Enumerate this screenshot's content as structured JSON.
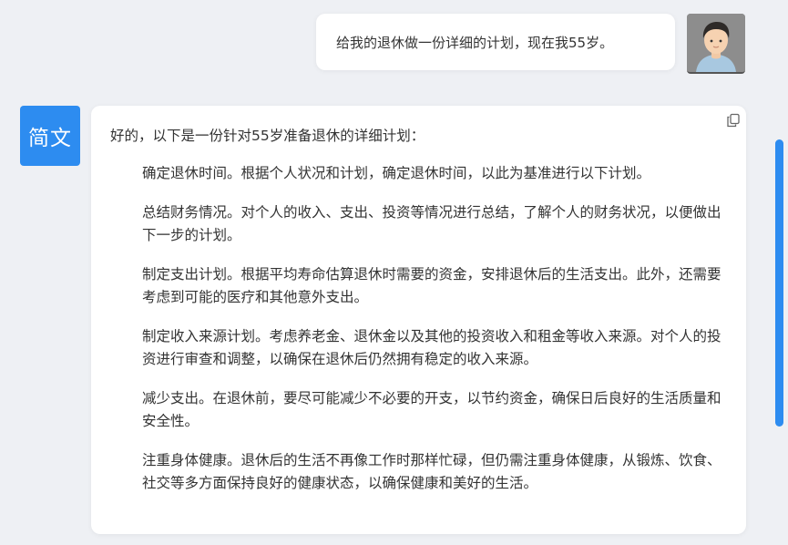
{
  "user_message": {
    "text": "给我的退休做一份详细的计划，现在我55岁。"
  },
  "bot": {
    "avatar_label": "简文",
    "intro": "好的，以下是一份针对55岁准备退休的详细计划：",
    "items": [
      "确定退休时间。根据个人状况和计划，确定退休时间，以此为基准进行以下计划。",
      "总结财务情况。对个人的收入、支出、投资等情况进行总结，了解个人的财务状况，以便做出下一步的计划。",
      "制定支出计划。根据平均寿命估算退休时需要的资金，安排退休后的生活支出。此外，还需要考虑到可能的医疗和其他意外支出。",
      "制定收入来源计划。考虑养老金、退休金以及其他的投资收入和租金等收入来源。对个人的投资进行审查和调整，以确保在退休后仍然拥有稳定的收入来源。",
      "减少支出。在退休前，要尽可能减少不必要的开支，以节约资金，确保日后良好的生活质量和安全性。",
      "注重身体健康。退休后的生活不再像工作时那样忙碌，但仍需注重身体健康，从锻炼、饮食、社交等多方面保持良好的健康状态，以确保健康和美好的生活。"
    ]
  },
  "icons": {
    "copy": "copy-icon",
    "user_avatar": "person-avatar-icon"
  },
  "colors": {
    "accent": "#2d8cf0",
    "background": "#eef0f4",
    "card": "#ffffff",
    "text": "#333333"
  }
}
